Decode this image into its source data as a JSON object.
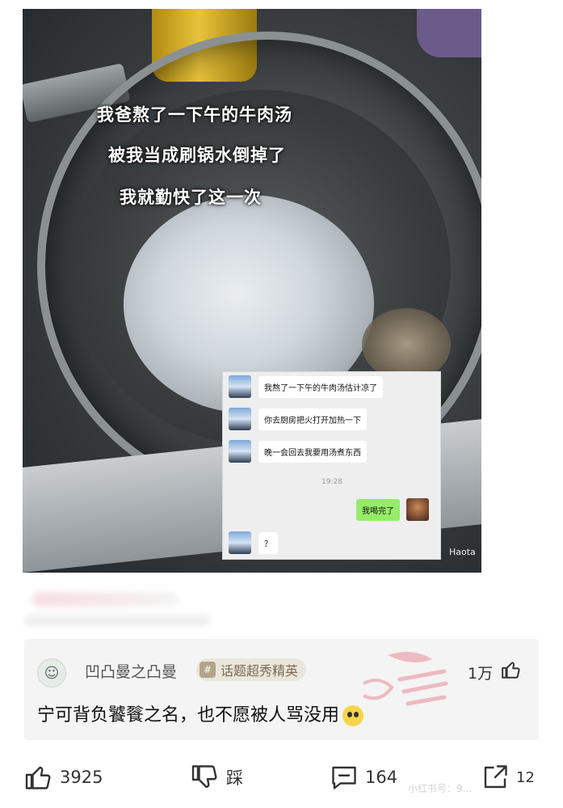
{
  "photo": {
    "caption_lines": [
      "我爸熬了一下午的牛肉汤",
      "被我当成刷锅水倒掉了",
      "我就勤快了这一次"
    ],
    "watermark": "Haota"
  },
  "chat": {
    "messages": [
      {
        "from": "other",
        "text": "我熬了一下午的牛肉汤估计凉了"
      },
      {
        "from": "other",
        "text": "你去厨房把火打开加热一下"
      },
      {
        "from": "other",
        "text": "晚一会回去我要用汤煮东西"
      },
      {
        "from": "self",
        "text": "我喝完了"
      },
      {
        "from": "other",
        "text": "？"
      }
    ],
    "time": "19:28"
  },
  "comment": {
    "username": "凹凸曼之凸曼",
    "badge_icon": "#",
    "badge": "话题超秀精英",
    "likes": "1万",
    "text": "宁可背负饕餮之名，也不愿被人骂没用"
  },
  "actions": {
    "like_count": "3925",
    "dislike_label": "踩",
    "comment_count": "164",
    "share_count": "12"
  },
  "footer_watermark": "小红书号：9..."
}
